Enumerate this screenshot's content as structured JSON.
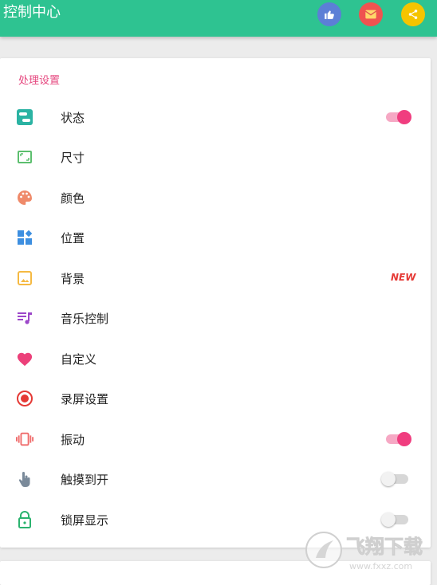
{
  "appbar": {
    "title": "控制中心",
    "actions": [
      {
        "icon": "thumbs-up-icon",
        "color": "#5c7fd6"
      },
      {
        "icon": "mail-icon",
        "color": "#ef5350"
      },
      {
        "icon": "share-icon",
        "color": "#f5c400"
      }
    ],
    "color": "#2ec391"
  },
  "section": {
    "title": "处理设置",
    "items": [
      {
        "label": "状态",
        "icon": "status-toggle-icon",
        "icon_color": "#2bb3a3",
        "control": "toggle",
        "on": true
      },
      {
        "label": "尺寸",
        "icon": "resize-icon",
        "icon_color": "#5cbf6e",
        "control": "none"
      },
      {
        "label": "颜色",
        "icon": "palette-icon",
        "icon_color": "#ef8a6a",
        "control": "none"
      },
      {
        "label": "位置",
        "icon": "layout-icon",
        "icon_color": "#3d8fe0",
        "control": "none"
      },
      {
        "label": "背景",
        "icon": "image-icon",
        "icon_color": "#f5b942",
        "control": "badge",
        "badge": "NEW"
      },
      {
        "label": "音乐控制",
        "icon": "music-list-icon",
        "icon_color": "#9c47c9",
        "control": "none"
      },
      {
        "label": "自定义",
        "icon": "heart-icon",
        "icon_color": "#ec407a",
        "control": "none"
      },
      {
        "label": "录屏设置",
        "icon": "record-icon",
        "icon_color": "#e53935",
        "control": "none"
      },
      {
        "label": "振动",
        "icon": "vibrate-icon",
        "icon_color": "#ef6a6a",
        "control": "toggle",
        "on": true
      },
      {
        "label": "触摸到开",
        "icon": "touch-icon",
        "icon_color": "#7a8a9a",
        "control": "toggle",
        "on": false
      },
      {
        "label": "锁屏显示",
        "icon": "lock-icon",
        "icon_color": "#2bb36f",
        "control": "toggle",
        "on": false
      }
    ]
  },
  "colors": {
    "accent": "#f03d7f",
    "section_title": "#e64980",
    "badge": "#e53935"
  },
  "watermark": {
    "text": "飞翔下载",
    "url_text": "www.fxxz.com"
  }
}
